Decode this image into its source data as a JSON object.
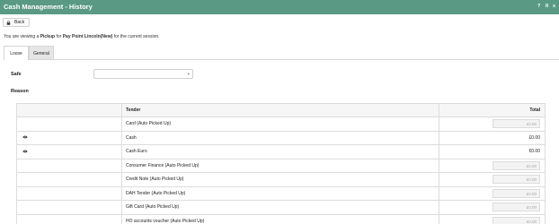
{
  "window": {
    "title": "Cash Management - History",
    "controls": [
      "?",
      "II",
      "x"
    ]
  },
  "toolbar": {
    "back_label": "Back"
  },
  "info": {
    "prefix": "You are viewing a ",
    "action": "Pickup",
    "mid": " for ",
    "location": "Pay Point Lincoln(New)",
    "suffix": " for the current session."
  },
  "tabs": [
    {
      "label": "Loose",
      "active": true
    },
    {
      "label": "General",
      "active": false
    }
  ],
  "form": {
    "safe_label": "Safe",
    "safe_value": "",
    "reason_label": "Reason"
  },
  "table": {
    "headers": [
      "",
      "Tender",
      "Total"
    ],
    "rows": [
      {
        "icon": "",
        "tender": "Card (Auto Picked Up)",
        "total": "£0.00",
        "editable": false
      },
      {
        "icon": "eye-icon",
        "tender": "Cash",
        "total": "£0.00",
        "editable": true
      },
      {
        "icon": "eye-icon",
        "tender": "Cash Euro",
        "total": "€0.00",
        "editable": true
      },
      {
        "icon": "",
        "tender": "Consumer Finance (Auto Picked Up)",
        "total": "£0.00",
        "editable": false
      },
      {
        "icon": "",
        "tender": "Credit Note (Auto Picked Up)",
        "total": "£0.00",
        "editable": false
      },
      {
        "icon": "",
        "tender": "DAH Tender (Auto Picked Up)",
        "total": "£0.00",
        "editable": false
      },
      {
        "icon": "",
        "tender": "Gift Card (Auto Picked Up)",
        "total": "£0.00",
        "editable": false
      },
      {
        "icon": "",
        "tender": "HO accounts voucher (Auto Picked Up)",
        "total": "£0.00",
        "editable": false
      }
    ]
  },
  "colors": {
    "titlebar": "#5a9a85",
    "tab_inactive": "#e6e6e6",
    "border": "#dcdcdc"
  }
}
